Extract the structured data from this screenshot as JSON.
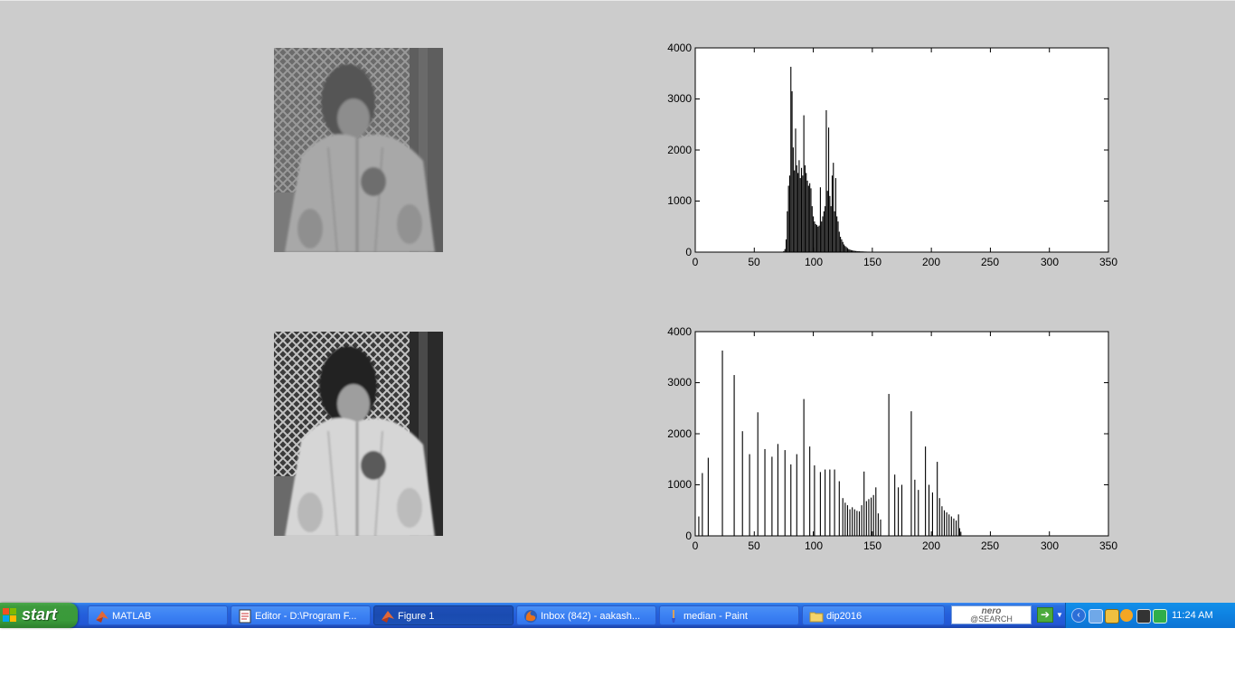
{
  "figure": {
    "histogram_top": {
      "y_ticks": [
        "4000",
        "3000",
        "2000",
        "1000",
        "0"
      ],
      "x_ticks": [
        "0",
        "50",
        "100",
        "150",
        "200",
        "250",
        "300",
        "350"
      ]
    },
    "histogram_bottom": {
      "y_ticks": [
        "4000",
        "3000",
        "2000",
        "1000",
        "0"
      ],
      "x_ticks": [
        "0",
        "50",
        "100",
        "150",
        "200",
        "250",
        "300",
        "350"
      ]
    }
  },
  "chart_data": [
    {
      "type": "bar",
      "xlim": [
        0,
        350
      ],
      "ylim": [
        0,
        4000
      ],
      "x": [
        75,
        76,
        77,
        78,
        79,
        80,
        81,
        82,
        83,
        84,
        85,
        86,
        87,
        88,
        89,
        90,
        91,
        92,
        93,
        94,
        95,
        96,
        97,
        98,
        99,
        100,
        101,
        102,
        103,
        104,
        105,
        106,
        107,
        108,
        109,
        110,
        111,
        112,
        113,
        114,
        115,
        116,
        117,
        118,
        119,
        120,
        121,
        122,
        123,
        124,
        125,
        126,
        127,
        128,
        129,
        130,
        131,
        132,
        133,
        134,
        135,
        136,
        137,
        138,
        139,
        140,
        141,
        142,
        143,
        144,
        145,
        146,
        147,
        148,
        149,
        150,
        151,
        152,
        153,
        154,
        155,
        156,
        157,
        158,
        159,
        160,
        162,
        164,
        166,
        168,
        170,
        173,
        176,
        180,
        185,
        190,
        195,
        200,
        205,
        210,
        215,
        220,
        225
      ],
      "values": [
        20,
        60,
        250,
        800,
        1300,
        1500,
        3630,
        3150,
        2050,
        1600,
        2420,
        1700,
        1550,
        1800,
        1450,
        1650,
        1500,
        2680,
        1700,
        1550,
        1400,
        1300,
        1350,
        1250,
        900,
        700,
        600,
        550,
        530,
        500,
        520,
        1270,
        600,
        700,
        800,
        900,
        2780,
        1200,
        2440,
        1100,
        900,
        1500,
        1750,
        800,
        1450,
        700,
        600,
        400,
        300,
        250,
        200,
        150,
        120,
        100,
        80,
        60,
        50,
        40,
        35,
        30,
        25,
        22,
        20,
        18,
        16,
        15,
        14,
        13,
        12,
        11,
        10,
        9,
        8,
        7,
        6,
        6,
        5,
        5,
        4,
        4,
        3,
        3,
        3,
        2,
        2,
        2,
        2,
        1,
        1,
        1,
        1,
        1,
        1,
        1,
        1,
        1,
        1,
        1,
        1,
        1,
        1,
        1,
        1
      ]
    },
    {
      "type": "bar",
      "xlim": [
        0,
        350
      ],
      "ylim": [
        0,
        4000
      ],
      "x": [
        3,
        6,
        11,
        23,
        33,
        40,
        46,
        53,
        59,
        65,
        70,
        76,
        81,
        86,
        92,
        97,
        101,
        106,
        110,
        114,
        118,
        122,
        125,
        127,
        129,
        131,
        133,
        135,
        137,
        139,
        141,
        143,
        145,
        147,
        149,
        151,
        153,
        155,
        157,
        164,
        169,
        172,
        175,
        183,
        186,
        189,
        195,
        198,
        201,
        205,
        207,
        209,
        211,
        213,
        215,
        217,
        219,
        221,
        223,
        224,
        225
      ],
      "values": [
        380,
        1230,
        1530,
        3630,
        3150,
        2050,
        1600,
        2420,
        1700,
        1550,
        1800,
        1680,
        1400,
        1600,
        2680,
        1750,
        1380,
        1250,
        1300,
        1300,
        1300,
        1070,
        740,
        650,
        600,
        520,
        560,
        520,
        490,
        480,
        600,
        1260,
        680,
        720,
        750,
        800,
        950,
        440,
        320,
        2780,
        1200,
        950,
        1000,
        2440,
        1100,
        900,
        1750,
        1000,
        850,
        1450,
        740,
        580,
        500,
        460,
        420,
        380,
        340,
        300,
        420,
        150,
        80
      ]
    }
  ],
  "taskbar": {
    "start_label": "start",
    "tasks": [
      {
        "label": "MATLAB",
        "icon": "matlab-icon"
      },
      {
        "label": "Editor - D:\\Program F...",
        "icon": "editor-icon"
      },
      {
        "label": "Figure 1",
        "icon": "matlab-icon"
      },
      {
        "label": "Inbox (842) - aakash...",
        "icon": "firefox-icon"
      },
      {
        "label": "median - Paint",
        "icon": "paint-icon"
      },
      {
        "label": "dip2016",
        "icon": "folder-icon"
      }
    ],
    "nero_brand": "nero",
    "nero_sub": "@SEARCH",
    "clock": "11:24 AM"
  }
}
